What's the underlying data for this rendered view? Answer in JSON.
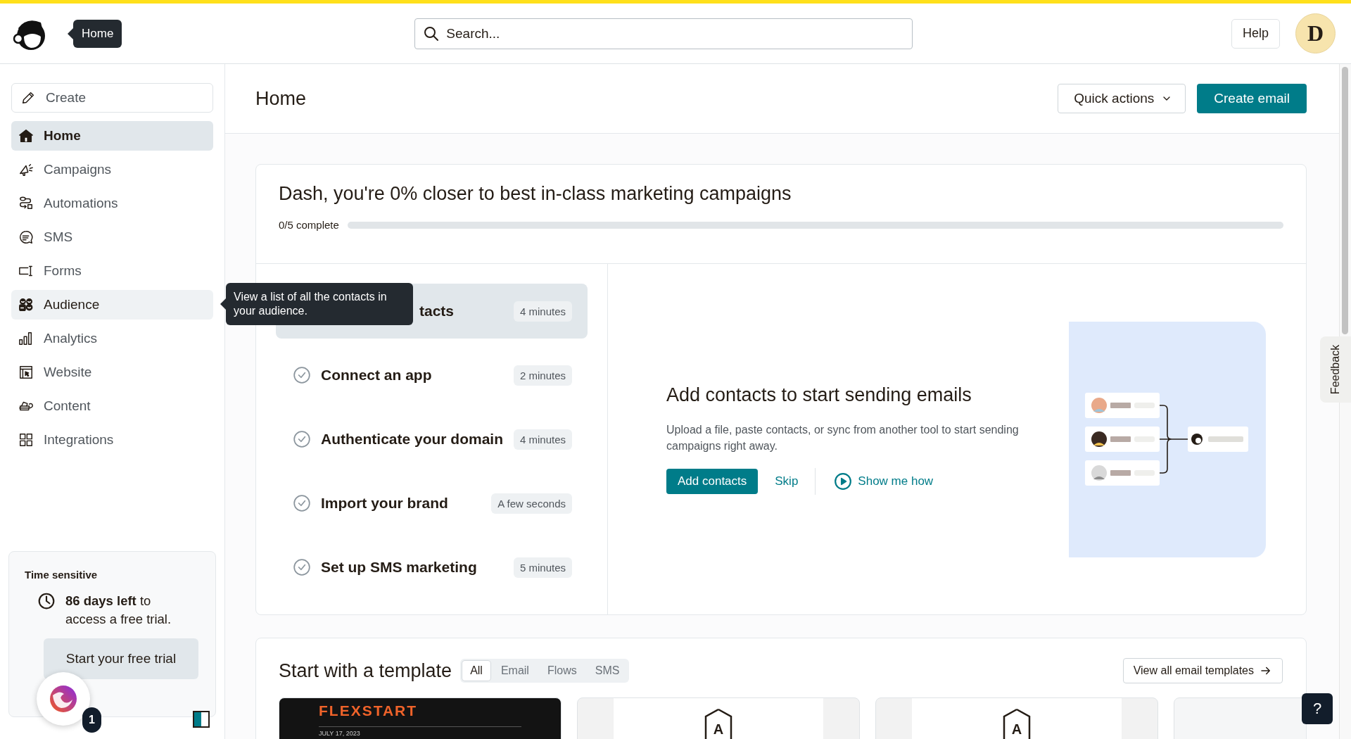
{
  "header": {
    "logo_tooltip": "Home",
    "search": {
      "placeholder": "Search..."
    },
    "help": "Help",
    "avatar": "D"
  },
  "sidebar": {
    "create": "Create",
    "items": [
      {
        "label": "Home",
        "selected": true,
        "hovered": false
      },
      {
        "label": "Campaigns",
        "selected": false,
        "hovered": false
      },
      {
        "label": "Automations",
        "selected": false,
        "hovered": false
      },
      {
        "label": "SMS",
        "selected": false,
        "hovered": false
      },
      {
        "label": "Forms",
        "selected": false,
        "hovered": false
      },
      {
        "label": "Audience",
        "selected": false,
        "hovered": true
      },
      {
        "label": "Analytics",
        "selected": false,
        "hovered": false
      },
      {
        "label": "Website",
        "selected": false,
        "hovered": false
      },
      {
        "label": "Content",
        "selected": false,
        "hovered": false
      },
      {
        "label": "Integrations",
        "selected": false,
        "hovered": false
      }
    ],
    "tooltip": "View a list of all the contacts in your audience.",
    "trial": {
      "heading": "Time sensitive",
      "message": "**86 days left** to access a free trial.",
      "button": "Start your free trial"
    },
    "notification_count": "1"
  },
  "page": {
    "title": "Home",
    "quick_actions": "Quick actions",
    "create_email": "Create email"
  },
  "onboarding": {
    "title": "Dash, you're 0% closer to best in-class marketing campaigns",
    "progress_label": "0/5 complete",
    "progress": {
      "level": 0
    },
    "tasks": [
      {
        "title": "tacts",
        "duration": "4 minutes",
        "selected": true,
        "covered": true
      },
      {
        "title": "Connect an app",
        "duration": "2 minutes",
        "selected": false,
        "covered": false
      },
      {
        "title": "Authenticate your domain",
        "duration": "4 minutes",
        "selected": false,
        "covered": false
      },
      {
        "title": "Import your brand",
        "duration": "A few seconds",
        "selected": false,
        "covered": false
      },
      {
        "title": "Set up SMS marketing",
        "duration": "5 minutes",
        "selected": false,
        "covered": false
      }
    ],
    "detail": {
      "title": "Add contacts to start sending emails",
      "description": "Upload a file, paste contacts, or sync from another tool to start sending campaigns right away.",
      "primary": "Add contacts",
      "skip": "Skip",
      "video": "Show me how"
    }
  },
  "templates": {
    "title": "Start with a template",
    "filters": [
      {
        "label": "All",
        "selected": true
      },
      {
        "label": "Email",
        "selected": false
      },
      {
        "label": "Flows",
        "selected": false
      },
      {
        "label": "SMS",
        "selected": false
      }
    ],
    "view_all": "View all email templates",
    "cards": [
      {
        "kind": "newsletter",
        "heading": "FLEXSTART",
        "date": "JULY 17, 2023"
      },
      {
        "kind": "logo",
        "mark": "A"
      },
      {
        "kind": "logo",
        "mark": "A"
      },
      {
        "kind": "blank"
      }
    ]
  },
  "feedback": "Feedback",
  "help_button": "?"
}
